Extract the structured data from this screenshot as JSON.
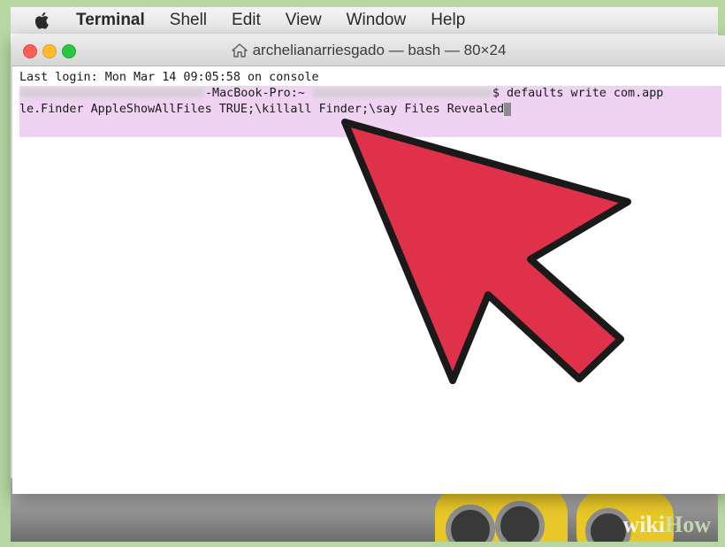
{
  "menubar": {
    "apple_icon": "apple-logo-icon",
    "items": [
      "Terminal",
      "Shell",
      "Edit",
      "View",
      "Window",
      "Help"
    ]
  },
  "window": {
    "title": "archelianarriesgado — bash — 80×24",
    "title_icon": "home-icon",
    "buttons": [
      "close",
      "minimize",
      "zoom"
    ],
    "colors": {
      "close": "#fc5f57",
      "minimize": "#fdbc2e",
      "zoom": "#28c840"
    }
  },
  "terminal": {
    "last_login": "Last login: Mon Mar 14 09:05:58 on console",
    "prompt_host": "-MacBook-Pro:~",
    "prompt_symbol": "$",
    "command_part1": " defaults write com.app",
    "command_part2": "le.Finder AppleShowAllFiles TRUE;\\killall Finder;\\say Files Revealed",
    "highlight_color": "#f0d2f3"
  },
  "annotation": {
    "type": "arrow-icon",
    "color": "#e0314a"
  },
  "watermark": {
    "part1": "wiki",
    "part2": "How"
  }
}
